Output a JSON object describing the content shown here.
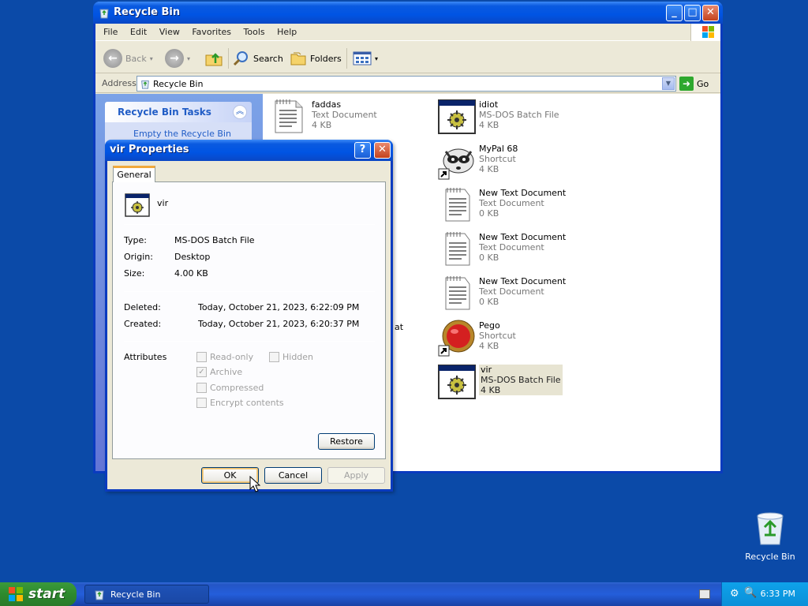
{
  "explorer": {
    "title": "Recycle Bin",
    "menu": [
      "File",
      "Edit",
      "View",
      "Favorites",
      "Tools",
      "Help"
    ],
    "toolbar": {
      "back": "Back",
      "search": "Search",
      "folders": "Folders"
    },
    "address": {
      "label": "Address",
      "value": "Recycle Bin",
      "go": "Go"
    },
    "tasks": {
      "title": "Recycle Bin Tasks",
      "empty": "Empty the Recycle Bin"
    },
    "files": [
      {
        "name": "faddas",
        "type": "Text Document",
        "size": "4 KB",
        "icon": "text-document-icon"
      },
      {
        "name": "idiot",
        "type": "MS-DOS Batch File",
        "size": "4 KB",
        "icon": "batch-file-icon"
      },
      {
        "name": "MyPal 68",
        "type": "Shortcut",
        "size": "4 KB",
        "icon": "raccoon-shortcut-icon"
      },
      {
        "name": "New Text Document",
        "type": "Text Document",
        "size": "0 KB",
        "icon": "text-document-icon"
      },
      {
        "name": "New Text Document",
        "type": "Text Document",
        "size": "0 KB",
        "icon": "text-document-icon"
      },
      {
        "name": "New Text Document",
        "type": "Text Document",
        "size": "0 KB",
        "icon": "text-document-icon"
      },
      {
        "name": "Pego",
        "type": "Shortcut",
        "size": "4 KB",
        "icon": "red-orb-shortcut-icon"
      },
      {
        "name": "vir",
        "type": "MS-DOS Batch File",
        "size": "4 KB",
        "icon": "batch-file-icon"
      }
    ],
    "partial_text": "at"
  },
  "dialog": {
    "title": "vir Properties",
    "tab": "General",
    "name": "vir",
    "type_label": "Type:",
    "type_value": "MS-DOS Batch File",
    "origin_label": "Origin:",
    "origin_value": "Desktop",
    "size_label": "Size:",
    "size_value": "4.00 KB",
    "deleted_label": "Deleted:",
    "deleted_value": "Today, October 21, 2023, 6:22:09 PM",
    "created_label": "Created:",
    "created_value": "Today, October 21, 2023, 6:20:37 PM",
    "attributes_label": "Attributes",
    "attributes": {
      "readonly": "Read-only",
      "hidden": "Hidden",
      "archive": "Archive",
      "compressed": "Compressed",
      "encrypt": "Encrypt contents"
    },
    "restore": "Restore",
    "ok": "OK",
    "cancel": "Cancel",
    "apply": "Apply"
  },
  "desktop": {
    "recycle_bin": "Recycle Bin"
  },
  "taskbar": {
    "start": "start",
    "task": "Recycle Bin",
    "clock": "6:33 PM"
  },
  "colors": {
    "desktop": "#0b4aa8",
    "title_blue": "#0054e3",
    "start_green": "#3c9a3c"
  }
}
